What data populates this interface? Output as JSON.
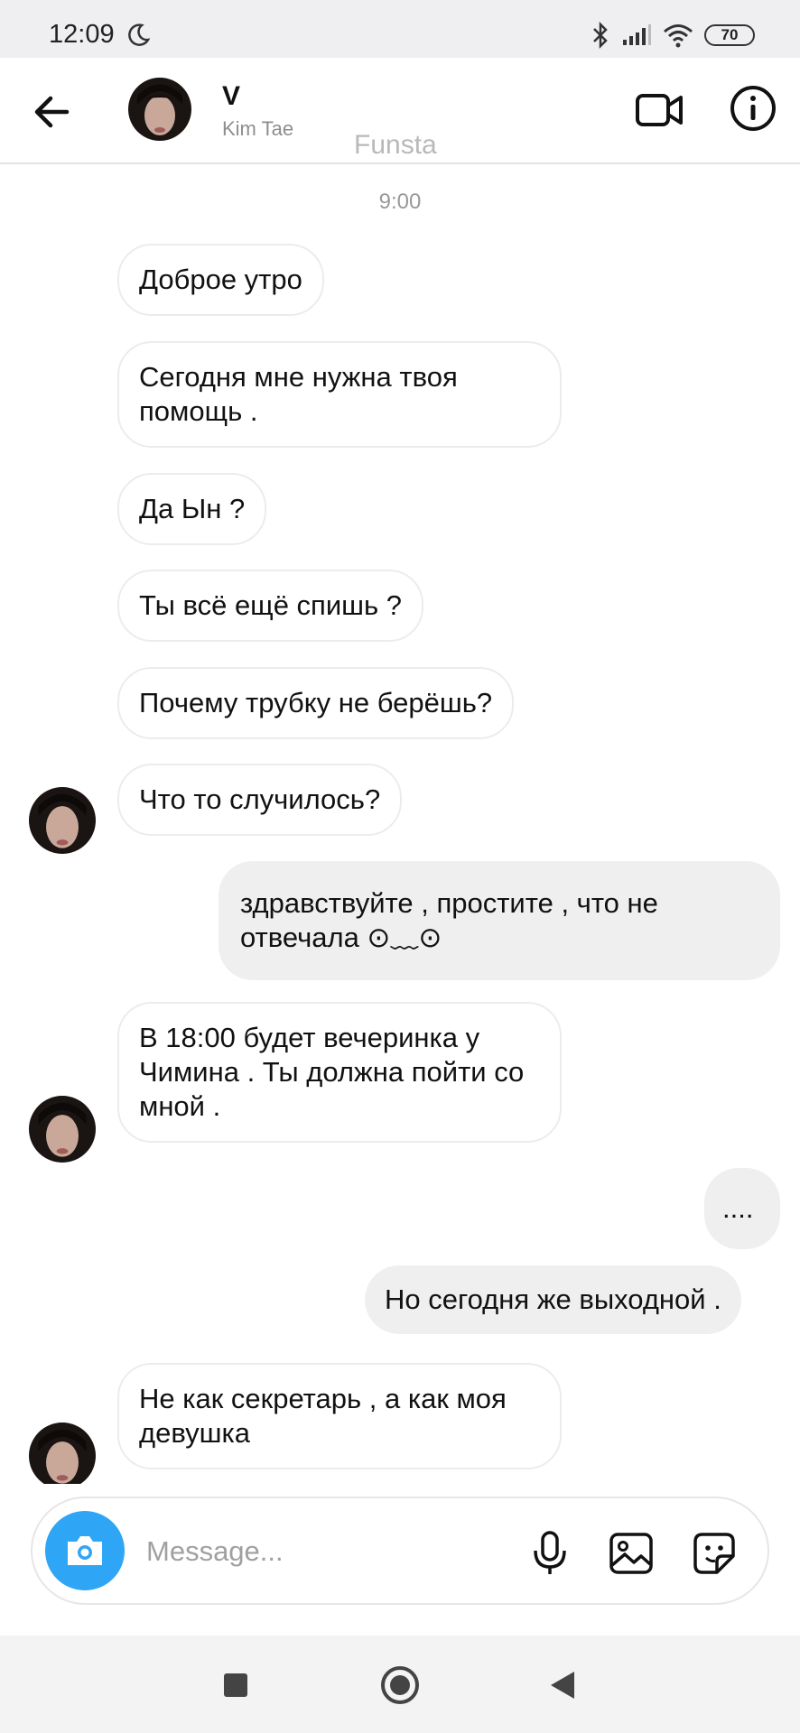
{
  "status_bar": {
    "time": "12:09",
    "battery": "70"
  },
  "header": {
    "name": "V",
    "subtitle": "Kim Tae",
    "watermark": "Funsta"
  },
  "chat": {
    "timestamp": "9:00",
    "messages": [
      {
        "dir": "in",
        "text": "Доброе утро"
      },
      {
        "dir": "in",
        "text": "Сегодня мне нужна твоя помощь ."
      },
      {
        "dir": "in",
        "text": "Да Ын ?"
      },
      {
        "dir": "in",
        "text": "Ты всё ещё спишь ?"
      },
      {
        "dir": "in",
        "text": "Почему трубку не берёшь?"
      },
      {
        "dir": "in",
        "text": "Что то случилось?"
      },
      {
        "dir": "out",
        "text": "здравствуйте , простите , что не отвечала ⊙﹏⊙"
      },
      {
        "dir": "in",
        "text": "В 18:00 будет вечеринка у Чимина . Ты должна пойти со мной ."
      },
      {
        "dir": "out",
        "text": "...."
      },
      {
        "dir": "out",
        "text": "Но сегодня же выходной ."
      },
      {
        "dir": "in",
        "text": "Не как секретарь , а как моя девушка"
      }
    ]
  },
  "composer": {
    "placeholder": "Message..."
  },
  "icons": {
    "back": "arrow-left-icon",
    "video": "video-camera-icon",
    "info": "info-icon",
    "camera": "camera-icon",
    "mic": "microphone-icon",
    "gallery": "image-icon",
    "sticker": "sticker-icon"
  },
  "colors": {
    "accent": "#2fa5f5",
    "outgoing_bubble": "#efefef",
    "incoming_border": "#ececec"
  }
}
